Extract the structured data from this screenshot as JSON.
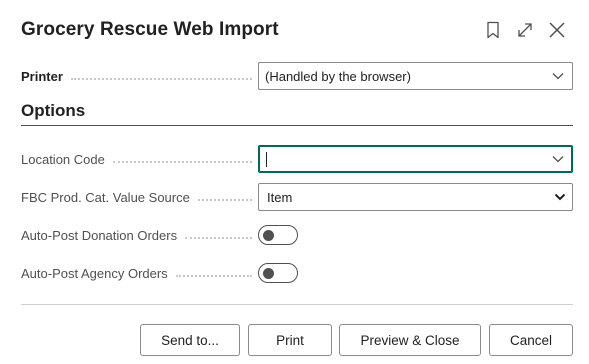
{
  "dialog": {
    "title": "Grocery Rescue Web Import",
    "icons": [
      "bookmark-icon",
      "expand-icon",
      "close-icon"
    ]
  },
  "printer": {
    "label": "Printer",
    "value": "(Handled by the browser)"
  },
  "options": {
    "section_title": "Options",
    "location_code": {
      "label": "Location Code",
      "value": ""
    },
    "fbc_prod_cat": {
      "label": "FBC Prod. Cat. Value Source",
      "value": "Item"
    },
    "auto_post_donation": {
      "label": "Auto-Post Donation Orders",
      "on": false
    },
    "auto_post_agency": {
      "label": "Auto-Post Agency Orders",
      "on": false
    }
  },
  "buttons": {
    "send_to": "Send to...",
    "print": "Print",
    "preview_close": "Preview & Close",
    "cancel": "Cancel"
  },
  "colors": {
    "focus_accent": "#00695c",
    "text": "#212121",
    "label": "#505050"
  }
}
